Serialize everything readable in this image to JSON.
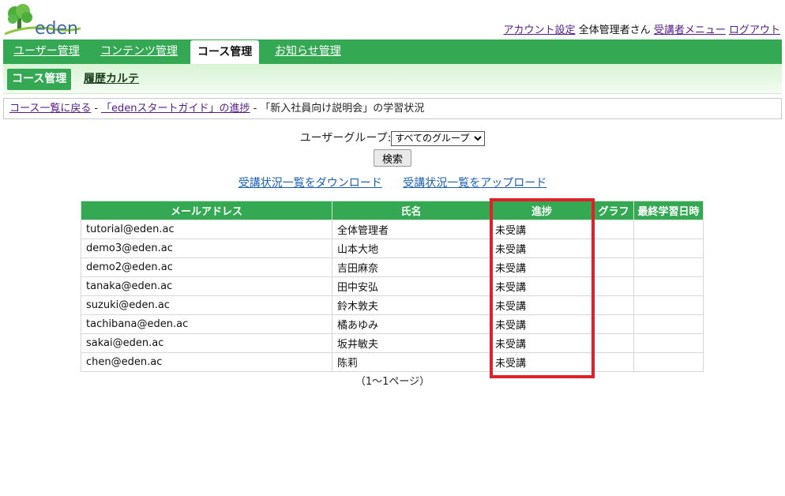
{
  "header": {
    "logo_text": "eden",
    "account_settings": "アカウント設定",
    "user_name": "全体管理者さん",
    "learner_menu": "受講者メニュー",
    "logout": "ログアウト"
  },
  "main_nav": {
    "tabs": [
      {
        "label": "ユーザー管理"
      },
      {
        "label": "コンテンツ管理"
      },
      {
        "label": "コース管理"
      },
      {
        "label": "お知らせ管理"
      }
    ]
  },
  "sub_nav": {
    "active": "コース管理",
    "history": "履歴カルテ"
  },
  "breadcrumb": {
    "back": "コース一覧に戻る",
    "sep": "-",
    "progress_link": "「edenスタートガイド」の進捗",
    "current": "「新入社員向け説明会」の学習状況"
  },
  "filter": {
    "label": "ユーザーグループ:",
    "selected": "すべてのグループ",
    "search_button": "検索",
    "download": "受講状況一覧をダウンロード",
    "upload": "受講状況一覧をアップロード"
  },
  "table": {
    "headers": {
      "email": "メールアドレス",
      "name": "氏名",
      "progress": "進捗",
      "graph": "グラフ",
      "last": "最終学習日時"
    },
    "rows": [
      {
        "email": "tutorial@eden.ac",
        "name": "全体管理者",
        "progress": "未受講"
      },
      {
        "email": "demo3@eden.ac",
        "name": "山本大地",
        "progress": "未受講"
      },
      {
        "email": "demo2@eden.ac",
        "name": "吉田麻奈",
        "progress": "未受講"
      },
      {
        "email": "tanaka@eden.ac",
        "name": "田中安弘",
        "progress": "未受講"
      },
      {
        "email": "suzuki@eden.ac",
        "name": "鈴木敦夫",
        "progress": "未受講"
      },
      {
        "email": "tachibana@eden.ac",
        "name": "橘あゆみ",
        "progress": "未受講"
      },
      {
        "email": "sakai@eden.ac",
        "name": "坂井敏夫",
        "progress": "未受講"
      },
      {
        "email": "chen@eden.ac",
        "name": "陈莉",
        "progress": "未受講"
      }
    ]
  },
  "pager": "（1～1ページ）",
  "colors": {
    "brand_green": "#34a853",
    "highlight_red": "#e0202a",
    "link_purple": "#551a8b",
    "link_blue": "#1a5fb4"
  }
}
